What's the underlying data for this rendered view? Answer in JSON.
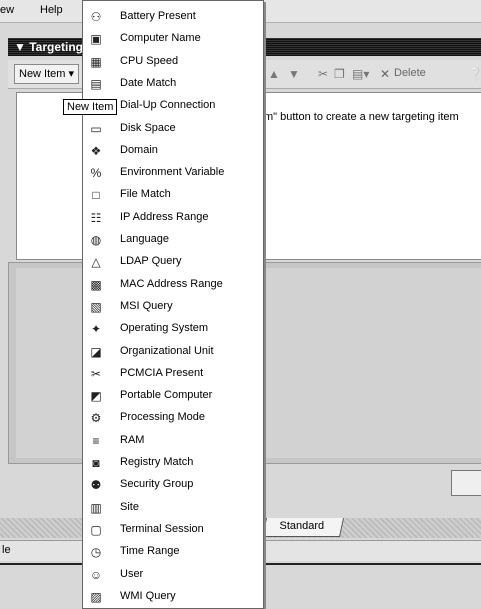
{
  "menubar": {
    "view_partial": "ew",
    "help": "Help"
  },
  "window": {
    "title": "▼ Targeting"
  },
  "toolbar": {
    "new_item": "New Item ▾",
    "delete": "Delete"
  },
  "tooltip": "New Item",
  "content": {
    "hint_partial": "m\" button to create a new targeting item"
  },
  "tabs": {
    "standard": "Standard"
  },
  "statusbar": {
    "partial": "le"
  },
  "menu": {
    "items": [
      {
        "label": "Battery Present",
        "icon": "battery-icon"
      },
      {
        "label": "Computer Name",
        "icon": "computer-icon"
      },
      {
        "label": "CPU Speed",
        "icon": "cpu-icon"
      },
      {
        "label": "Date Match",
        "icon": "calendar-icon"
      },
      {
        "label": "Dial-Up Connection",
        "icon": "modem-icon"
      },
      {
        "label": "Disk Space",
        "icon": "disk-icon"
      },
      {
        "label": "Domain",
        "icon": "domain-icon"
      },
      {
        "label": "Environment Variable",
        "icon": "percent-icon"
      },
      {
        "label": "File Match",
        "icon": "file-icon"
      },
      {
        "label": "IP Address Range",
        "icon": "network-icon"
      },
      {
        "label": "Language",
        "icon": "globe-icon"
      },
      {
        "label": "LDAP Query",
        "icon": "ldap-icon"
      },
      {
        "label": "MAC Address Range",
        "icon": "nic-icon"
      },
      {
        "label": "MSI Query",
        "icon": "msi-icon"
      },
      {
        "label": "Operating System",
        "icon": "os-icon"
      },
      {
        "label": "Organizational Unit",
        "icon": "ou-icon"
      },
      {
        "label": "PCMCIA Present",
        "icon": "pcmcia-icon"
      },
      {
        "label": "Portable Computer",
        "icon": "laptop-icon"
      },
      {
        "label": "Processing Mode",
        "icon": "processing-icon"
      },
      {
        "label": "RAM",
        "icon": "ram-icon"
      },
      {
        "label": "Registry Match",
        "icon": "registry-icon"
      },
      {
        "label": "Security Group",
        "icon": "group-icon"
      },
      {
        "label": "Site",
        "icon": "site-icon"
      },
      {
        "label": "Terminal Session",
        "icon": "terminal-icon"
      },
      {
        "label": "Time Range",
        "icon": "clock-icon"
      },
      {
        "label": "User",
        "icon": "user-icon"
      },
      {
        "label": "WMI Query",
        "icon": "wmi-icon"
      }
    ]
  }
}
